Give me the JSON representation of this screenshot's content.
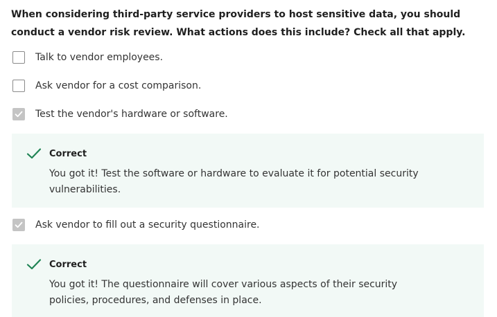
{
  "question": "When considering third-party service providers to host sensitive data, you should conduct a vendor risk review. What actions does this include? Check all that apply.",
  "options": [
    {
      "label": "Talk to vendor employees.",
      "checked": false
    },
    {
      "label": "Ask vendor for a cost comparison.",
      "checked": false
    },
    {
      "label": "Test the vendor's hardware or software.",
      "checked": true
    },
    {
      "label": "Ask vendor to fill out a security questionnaire.",
      "checked": true
    }
  ],
  "feedback": [
    {
      "title": "Correct",
      "text": "You got it! Test the software or hardware to evaluate it for potential security vulnerabilities."
    },
    {
      "title": "Correct",
      "text": "You got it! The questionnaire will cover various aspects of their security policies, procedures, and defenses in place."
    }
  ],
  "colors": {
    "correct_accent": "#1f8354",
    "feedback_background": "#f2f9f6",
    "checkbox_checked": "#c4c4c4"
  }
}
